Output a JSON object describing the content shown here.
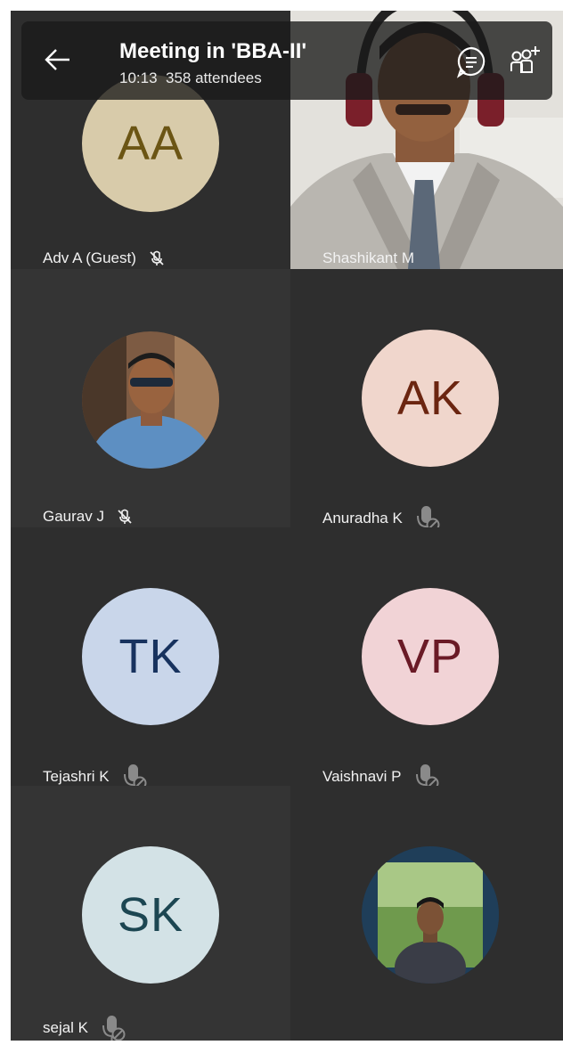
{
  "header": {
    "title": "Meeting in 'BBA-II'",
    "time": "10:13",
    "attendees": "358 attendees",
    "back_icon": "back-arrow-icon",
    "chat_icon": "chat-icon",
    "add_people_icon": "add-people-icon"
  },
  "participants": [
    {
      "name": "Adv A (Guest)",
      "initials": "AA",
      "avatar_bg": "#d8cbaa",
      "avatar_fg": "#6b5514",
      "mic": "muted-strike"
    },
    {
      "name": "Shashikant M",
      "video": true
    },
    {
      "name": "Gaurav J",
      "photo": true,
      "mic": "muted-strike"
    },
    {
      "name": "Anuradha K",
      "initials": "AK",
      "avatar_bg": "#f0d6cc",
      "avatar_fg": "#6b2510",
      "mic": "mic-off"
    },
    {
      "name": "Tejashri K",
      "initials": "TK",
      "avatar_bg": "#c9d6ea",
      "avatar_fg": "#17325e",
      "mic": "mic-off"
    },
    {
      "name": "Vaishnavi P",
      "initials": "VP",
      "avatar_bg": "#f1d3d6",
      "avatar_fg": "#6a1a26",
      "mic": "mic-off"
    },
    {
      "name": "sejal K",
      "initials": "SK",
      "avatar_bg": "#d3e2e6",
      "avatar_fg": "#1c4652",
      "mic": "mic-off"
    },
    {
      "name": "",
      "photo": true
    }
  ]
}
